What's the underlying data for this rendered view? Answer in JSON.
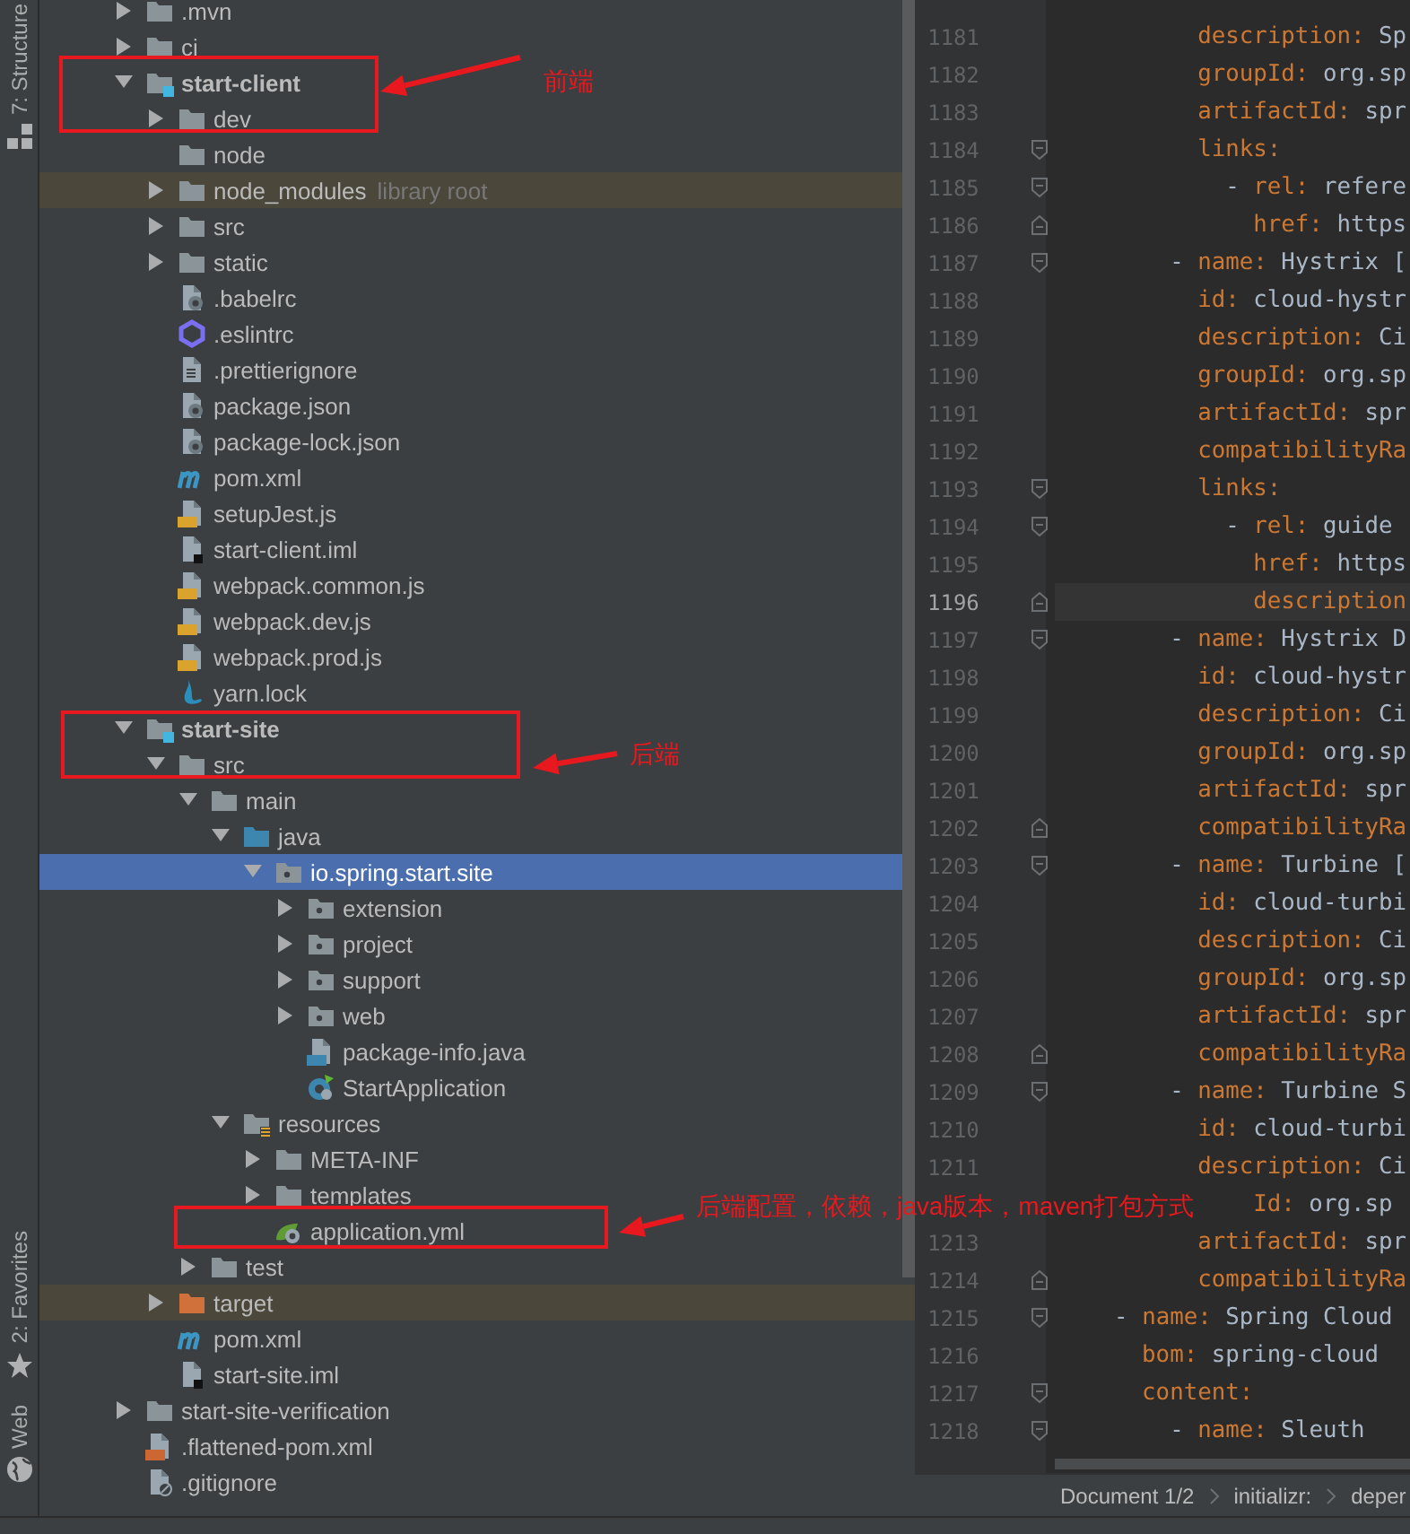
{
  "side_strip": {
    "top_tools": [
      {
        "label": "7: Structure",
        "kind": "structure"
      }
    ],
    "bottom_tools": [
      {
        "label": "2: Favorites",
        "kind": "star"
      },
      {
        "label": "Web",
        "kind": "globe"
      }
    ]
  },
  "project_tree": {
    "items": [
      {
        "label": ".mvn",
        "kind": "folder",
        "expanded": false,
        "selected": false,
        "excluded": false
      },
      {
        "label": "ci",
        "kind": "folder",
        "expanded": false,
        "selected": false,
        "excluded": false
      },
      {
        "label": "start-client",
        "kind": "module",
        "expanded": true,
        "selected": false,
        "excluded": false,
        "children": [
          {
            "label": "dev",
            "kind": "folder",
            "expanded": false,
            "selected": false,
            "excluded": false
          },
          {
            "label": "node",
            "kind": "leaf-folder",
            "selected": false,
            "excluded": false
          },
          {
            "label": "node_modules",
            "hint": "library root",
            "kind": "folder",
            "expanded": false,
            "selected": false,
            "excluded": true
          },
          {
            "label": "src",
            "kind": "folder",
            "expanded": false,
            "selected": false,
            "excluded": false
          },
          {
            "label": "static",
            "kind": "folder",
            "expanded": false,
            "selected": false,
            "excluded": false
          },
          {
            "label": ".babelrc",
            "kind": "config",
            "selected": false,
            "excluded": false
          },
          {
            "label": ".eslintrc",
            "kind": "eslint",
            "selected": false,
            "excluded": false
          },
          {
            "label": ".prettierignore",
            "kind": "text",
            "selected": false,
            "excluded": false
          },
          {
            "label": "package.json",
            "kind": "config",
            "selected": false,
            "excluded": false
          },
          {
            "label": "package-lock.json",
            "kind": "config",
            "selected": false,
            "excluded": false
          },
          {
            "label": "pom.xml",
            "kind": "maven",
            "selected": false,
            "excluded": false
          },
          {
            "label": "setupJest.js",
            "kind": "js",
            "selected": false,
            "excluded": false
          },
          {
            "label": "start-client.iml",
            "kind": "iml",
            "selected": false,
            "excluded": false
          },
          {
            "label": "webpack.common.js",
            "kind": "js",
            "selected": false,
            "excluded": false
          },
          {
            "label": "webpack.dev.js",
            "kind": "js",
            "selected": false,
            "excluded": false
          },
          {
            "label": "webpack.prod.js",
            "kind": "js",
            "selected": false,
            "excluded": false
          },
          {
            "label": "yarn.lock",
            "kind": "yarn",
            "selected": false,
            "excluded": false
          }
        ]
      },
      {
        "label": "start-site",
        "kind": "module",
        "expanded": true,
        "selected": false,
        "excluded": false,
        "children": [
          {
            "label": "src",
            "kind": "folder",
            "expanded": true,
            "selected": false,
            "excluded": false,
            "children": [
              {
                "label": "main",
                "kind": "folder",
                "expanded": true,
                "selected": false,
                "excluded": false,
                "children": [
                  {
                    "label": "java",
                    "kind": "source",
                    "expanded": true,
                    "selected": false,
                    "excluded": false,
                    "children": [
                      {
                        "label": "io.spring.start.site",
                        "kind": "package",
                        "expanded": true,
                        "selected": true,
                        "excluded": false,
                        "children": [
                          {
                            "label": "extension",
                            "kind": "package",
                            "expanded": false,
                            "selected": false,
                            "excluded": false
                          },
                          {
                            "label": "project",
                            "kind": "package",
                            "expanded": false,
                            "selected": false,
                            "excluded": false
                          },
                          {
                            "label": "support",
                            "kind": "package",
                            "expanded": false,
                            "selected": false,
                            "excluded": false
                          },
                          {
                            "label": "web",
                            "kind": "package",
                            "expanded": false,
                            "selected": false,
                            "excluded": false
                          },
                          {
                            "label": "package-info.java",
                            "kind": "java",
                            "selected": false,
                            "excluded": false
                          },
                          {
                            "label": "StartApplication",
                            "kind": "spring-class",
                            "selected": false,
                            "excluded": false
                          }
                        ]
                      }
                    ]
                  },
                  {
                    "label": "resources",
                    "kind": "resources",
                    "expanded": true,
                    "selected": false,
                    "excluded": false,
                    "children": [
                      {
                        "label": "META-INF",
                        "kind": "folder",
                        "expanded": false,
                        "selected": false,
                        "excluded": false
                      },
                      {
                        "label": "templates",
                        "kind": "folder",
                        "expanded": false,
                        "selected": false,
                        "excluded": false
                      },
                      {
                        "label": "application.yml",
                        "kind": "spring-yml",
                        "selected": false,
                        "excluded": false
                      }
                    ]
                  }
                ]
              },
              {
                "label": "test",
                "kind": "folder",
                "expanded": false,
                "selected": false,
                "excluded": false
              }
            ]
          },
          {
            "label": "target",
            "kind": "excluded-folder",
            "expanded": false,
            "selected": false,
            "excluded": true
          },
          {
            "label": "pom.xml",
            "kind": "maven",
            "selected": false,
            "excluded": false
          },
          {
            "label": "start-site.iml",
            "kind": "iml",
            "selected": false,
            "excluded": false
          }
        ]
      },
      {
        "label": "start-site-verification",
        "kind": "folder",
        "expanded": false,
        "selected": false,
        "excluded": false
      },
      {
        "label": ".flattened-pom.xml",
        "kind": "xml",
        "selected": false,
        "excluded": false
      },
      {
        "label": ".gitignore",
        "kind": "ignore",
        "selected": false,
        "excluded": false
      }
    ]
  },
  "annotations": [
    {
      "text": "前端"
    },
    {
      "text": "后端"
    },
    {
      "text": "后端配置，依赖，java版本，maven打包方式"
    }
  ],
  "editor": {
    "lines": [
      {
        "number": "1181",
        "key": "          description:",
        "value": "Sp",
        "kind": "plain",
        "current": false
      },
      {
        "number": "1182",
        "key": "          groupId:",
        "value": "org.sp",
        "kind": "plain",
        "current": false
      },
      {
        "number": "1183",
        "key": "          artifactId:",
        "value": "spr",
        "kind": "plain",
        "current": false
      },
      {
        "number": "1184",
        "key": "          links:",
        "kind": "fold-start",
        "current": false
      },
      {
        "number": "1185",
        "prefix": "            - ",
        "key": "rel:",
        "value": "refere",
        "kind": "fold-start",
        "current": false
      },
      {
        "number": "1186",
        "key": "              href:",
        "value": "https",
        "kind": "fold-end",
        "current": false
      },
      {
        "number": "1187",
        "prefix": "        - ",
        "key": "name:",
        "value": "Hystrix [",
        "kind": "fold-start",
        "current": false
      },
      {
        "number": "1188",
        "key": "          id:",
        "value": "cloud-hystr",
        "kind": "plain",
        "current": false
      },
      {
        "number": "1189",
        "key": "          description:",
        "value": "Ci",
        "kind": "plain",
        "current": false
      },
      {
        "number": "1190",
        "key": "          groupId:",
        "value": "org.sp",
        "kind": "plain",
        "current": false
      },
      {
        "number": "1191",
        "key": "          artifactId:",
        "value": "spr",
        "kind": "plain",
        "current": false
      },
      {
        "number": "1192",
        "key": "          compatibilityRa",
        "kind": "plain",
        "current": false
      },
      {
        "number": "1193",
        "key": "          links:",
        "kind": "fold-start",
        "current": false
      },
      {
        "number": "1194",
        "prefix": "            - ",
        "key": "rel:",
        "value": "guide",
        "kind": "fold-start",
        "current": false
      },
      {
        "number": "1195",
        "key": "              href:",
        "value": "https",
        "kind": "plain",
        "current": false
      },
      {
        "number": "1196",
        "key": "              description",
        "kind": "fold-end",
        "current": true
      },
      {
        "number": "1197",
        "prefix": "        - ",
        "key": "name:",
        "value": "Hystrix D",
        "kind": "fold-start",
        "current": false
      },
      {
        "number": "1198",
        "key": "          id:",
        "value": "cloud-hystr",
        "kind": "plain",
        "current": false
      },
      {
        "number": "1199",
        "key": "          description:",
        "value": "Ci",
        "kind": "plain",
        "current": false
      },
      {
        "number": "1200",
        "key": "          groupId:",
        "value": "org.sp",
        "kind": "plain",
        "current": false
      },
      {
        "number": "1201",
        "key": "          artifactId:",
        "value": "spr",
        "kind": "plain",
        "current": false
      },
      {
        "number": "1202",
        "key": "          compatibilityRa",
        "kind": "fold-end",
        "current": false
      },
      {
        "number": "1203",
        "prefix": "        - ",
        "key": "name:",
        "value": "Turbine [",
        "kind": "fold-start",
        "current": false
      },
      {
        "number": "1204",
        "key": "          id:",
        "value": "cloud-turbi",
        "kind": "plain",
        "current": false
      },
      {
        "number": "1205",
        "key": "          description:",
        "value": "Ci",
        "kind": "plain",
        "current": false
      },
      {
        "number": "1206",
        "key": "          groupId:",
        "value": "org.sp",
        "kind": "plain",
        "current": false
      },
      {
        "number": "1207",
        "key": "          artifactId:",
        "value": "spr",
        "kind": "plain",
        "current": false
      },
      {
        "number": "1208",
        "key": "          compatibilityRa",
        "kind": "fold-end",
        "current": false
      },
      {
        "number": "1209",
        "prefix": "        - ",
        "key": "name:",
        "value": "Turbine S",
        "kind": "fold-start",
        "current": false
      },
      {
        "number": "1210",
        "key": "          id:",
        "value": "cloud-turbi",
        "kind": "plain",
        "current": false
      },
      {
        "number": "1211",
        "key": "          description:",
        "value": "Ci",
        "kind": "plain",
        "current": false
      },
      {
        "key": "              Id:",
        "value": "org.sp",
        "kind": "plain"
      },
      {
        "number": "1213",
        "key": "          artifactId:",
        "value": "spr",
        "kind": "plain",
        "current": false
      },
      {
        "number": "1214",
        "key": "          compatibilityRa",
        "kind": "fold-end",
        "current": false
      },
      {
        "number": "1215",
        "prefix": "    - ",
        "key": "name:",
        "value": "Spring Cloud",
        "kind": "fold-start",
        "current": false
      },
      {
        "number": "1216",
        "key": "      bom:",
        "value": "spring-cloud",
        "kind": "plain",
        "current": false
      },
      {
        "number": "1217",
        "key": "      content:",
        "kind": "fold-start",
        "current": false
      },
      {
        "number": "1218",
        "prefix": "        - ",
        "key": "name:",
        "value": "Sleuth",
        "kind": "fold-start",
        "current": false
      }
    ],
    "breadcrumbs": [
      "Document 1/2",
      "initializr:",
      "deper"
    ]
  }
}
